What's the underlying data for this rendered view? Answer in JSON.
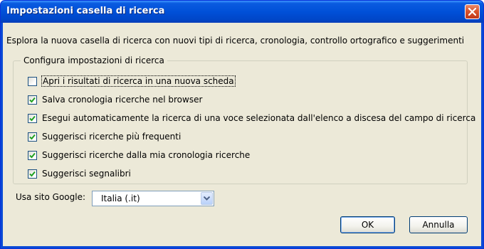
{
  "window": {
    "title": "Impostazioni casella di ricerca",
    "close_icon": "close-icon"
  },
  "description": "Esplora la nuova casella di ricerca con nuovi tipi di ricerca, cronologia, controllo ortografico e suggerimenti",
  "group": {
    "legend": "Configura impostazioni di ricerca",
    "options": [
      {
        "label": "Apri i risultati di ricerca in una nuova scheda",
        "checked": false
      },
      {
        "label": "Salva cronologia ricerche nel browser",
        "checked": true
      },
      {
        "label": "Esegui automaticamente la ricerca di una voce selezionata dall'elenco a discesa del campo di ricerca",
        "checked": true
      },
      {
        "label": "Suggerisci ricerche più frequenti",
        "checked": true
      },
      {
        "label": "Suggerisci ricerche dalla mia cronologia ricerche",
        "checked": true
      },
      {
        "label": "Suggerisci segnalibri",
        "checked": true
      }
    ]
  },
  "site": {
    "label": "Usa sito Google:",
    "selected": "Italia (.it)"
  },
  "buttons": {
    "ok": "OK",
    "cancel": "Annulla"
  },
  "colors": {
    "titlebar": "#0050d8",
    "client_bg": "#ece9d8",
    "check": "#21a121"
  }
}
